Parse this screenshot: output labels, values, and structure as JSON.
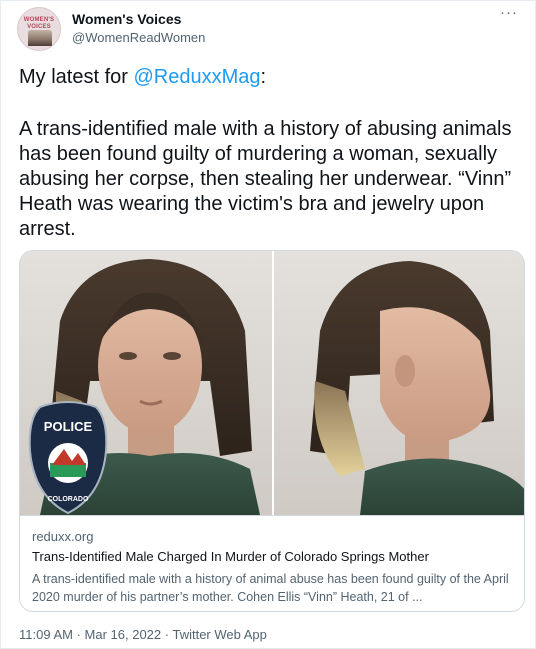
{
  "author": {
    "display_name": "Women's Voices",
    "handle": "@WomenReadWomen",
    "avatar_text": "WOMEN'S VOICES",
    "avatar_icon": "logo-avatar"
  },
  "menu": {
    "more_icon": "more-dots-icon",
    "more_label": "···"
  },
  "tweet": {
    "intro": "My latest for ",
    "mention": "@ReduxxMag",
    "intro_end": ":",
    "paragraph": "A trans-identified male with a history of abusing animals has been found guilty of murdering a woman, sexually abusing her corpse, then stealing her underwear. “Vinn” Heath was wearing the victim's bra and jewelry upon arrest."
  },
  "card": {
    "image_description_icon": "mugshot-photo",
    "badge_top": "POLICE",
    "badge_bottom": "COLORADO",
    "domain": "reduxx.org",
    "title": "Trans-Identified Male Charged In Murder of Colorado Springs Mother",
    "description": "A trans-identified male with a history of animal abuse has been found guilty of the April 2020 murder of his partner’s mother. Cohen Ellis “Vinn” Heath, 21 of ..."
  },
  "meta": {
    "time": "11:09 AM",
    "separator": " · ",
    "date": "Mar 16, 2022",
    "source": "Twitter Web App"
  },
  "colors": {
    "link": "#1d9bf0",
    "secondary_text": "#536471",
    "border": "#cfd9de"
  }
}
